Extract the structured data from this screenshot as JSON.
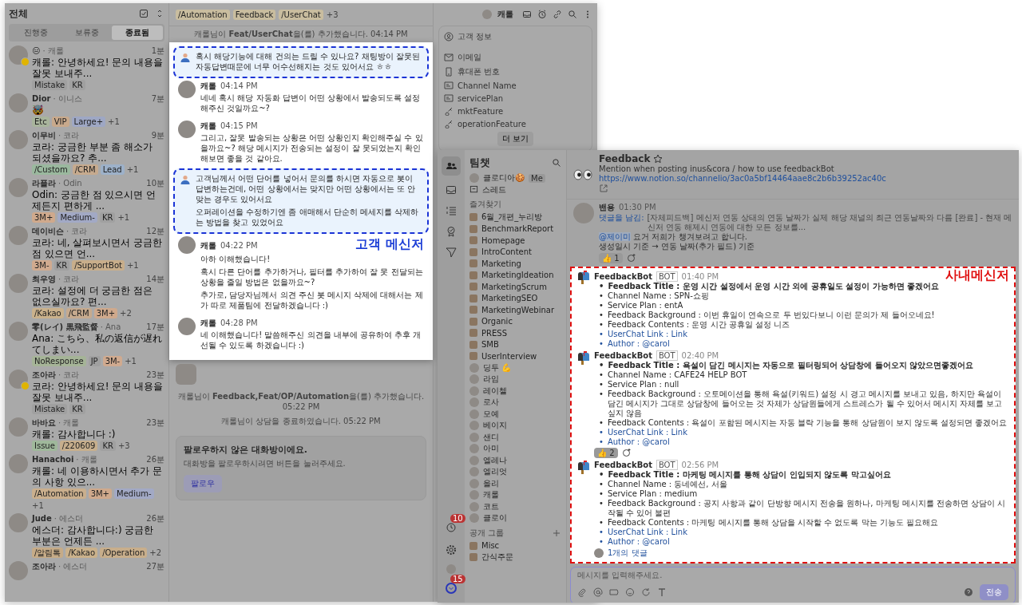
{
  "customer_window": {
    "inbox": {
      "title": "전체",
      "tabs": [
        {
          "label": "진행중",
          "selected": false
        },
        {
          "label": "보류중",
          "selected": false
        },
        {
          "label": "종료됨",
          "selected": true
        }
      ],
      "chats": [
        {
          "name": "😑",
          "agent": "· 캐롤",
          "time": "1분",
          "badge": true,
          "preview": "캐롤: 안녕하세요! 문의 내용을 잘못 보내주...",
          "tags": [
            {
              "label": "Mistake",
              "color": "#a0a0a0"
            },
            {
              "label": "KR",
              "color": "#a0a0a0"
            }
          ]
        },
        {
          "name": "Dior",
          "agent": "· 이니스",
          "time": "7분",
          "badge": false,
          "preview": "🤯",
          "tags": [
            {
              "label": "Etc",
              "color": "#a8b49c"
            },
            {
              "label": "VIP",
              "color": "#c8a98c"
            },
            {
              "label": "Large+",
              "color": "#9ea7c4"
            }
          ],
          "more": "+1"
        },
        {
          "name": "이무비",
          "agent": "· 코라",
          "time": "9분",
          "badge": false,
          "preview": "코라: 궁금한 부분 좀 해소가 되셨을까요? 추...",
          "tags": [
            {
              "label": "/Custom",
              "color": "#9ab89e"
            },
            {
              "label": "/CRM",
              "color": "#c6aa8e"
            },
            {
              "label": "Lead",
              "color": "#9db1c9"
            }
          ],
          "more": "+1"
        },
        {
          "name": "라플라",
          "agent": "· Odin",
          "time": "10분",
          "badge": false,
          "preview": "Odin: 궁금한 점 있으시면 언제든지 편하게 ...",
          "tags": [
            {
              "label": "3M+",
              "color": "#cfa98c"
            },
            {
              "label": "Medium-",
              "color": "#a2a9c5"
            },
            {
              "label": "KR",
              "color": "#a0a0a0"
            }
          ],
          "more": "+1"
        },
        {
          "name": "데이비슨",
          "agent": "· 코라",
          "time": "12분",
          "badge": false,
          "preview": "코라: 네, 살펴보시면서 궁금한 점 있으면 언...",
          "tags": [
            {
              "label": "3M-",
              "color": "#d0aa8f"
            },
            {
              "label": "KR",
              "color": "#a0a0a0"
            },
            {
              "label": "/SupportBot",
              "color": "#c8ae8b"
            }
          ],
          "more": "+1"
        },
        {
          "name": "최우영",
          "agent": "· 코라",
          "time": "14분",
          "badge": false,
          "preview": "코라: 설정에 더 궁금한 점은 없으실까요? 편...",
          "tags": [
            {
              "label": "/Kakao",
              "color": "#cab18b"
            },
            {
              "label": "/CRM",
              "color": "#c6aa8e"
            },
            {
              "label": "3M+",
              "color": "#cfa98c"
            }
          ],
          "more": "+2"
        },
        {
          "name": "零(レイ) 黒飛監督",
          "agent": "· Ana",
          "time": "17분",
          "badge": false,
          "preview": "Ana: こちら、私の返信が遅れてしまい...",
          "tags": [
            {
              "label": "NoResponse",
              "color": "#a5b497"
            },
            {
              "label": "JP",
              "color": "#a0a0a0"
            },
            {
              "label": "3M-",
              "color": "#d0aa8f"
            }
          ],
          "more": "+1"
        },
        {
          "name": "조아라",
          "agent": "· 코라",
          "time": "23분",
          "badge": true,
          "preview": "코라: 안녕하세요! 문의 내용을 잘못 보내주...",
          "tags": [
            {
              "label": "Mistake",
              "color": "#a0a0a0"
            },
            {
              "label": "KR",
              "color": "#a0a0a0"
            }
          ]
        },
        {
          "name": "바바요",
          "agent": "· 캐롤",
          "time": "23분",
          "badge": false,
          "preview": "캐롤: 감사합니다 :)",
          "tags": [
            {
              "label": "Issue",
              "color": "#9fb89b"
            },
            {
              "label": "/220609",
              "color": "#c7af8d"
            },
            {
              "label": "KR",
              "color": "#a0a0a0"
            }
          ],
          "more": "+3"
        },
        {
          "name": "Hanachoi",
          "agent": "· 캐롤",
          "time": "26분",
          "badge": false,
          "preview": "캐롤: 네 이용하시면서 추가 문의 사항 있으...",
          "tags": [
            {
              "label": "/Automation",
              "color": "#caaf8d"
            },
            {
              "label": "3M+",
              "color": "#cfa98c"
            },
            {
              "label": "Medium-",
              "color": "#a2a9c5"
            }
          ],
          "more": "+1"
        },
        {
          "name": "Jude",
          "agent": "· 에스더",
          "time": "26분",
          "badge": false,
          "preview": "에스더: 감사합니다:) 궁금한 부분은 언제든 ...",
          "tags": [
            {
              "label": "/알림톡",
              "color": "#c6ab87"
            },
            {
              "label": "/Kakao",
              "color": "#cab18b"
            },
            {
              "label": "/Operation",
              "color": "#c8ae8b"
            }
          ],
          "more": "+2"
        },
        {
          "name": "조아라",
          "agent": "· 에스더",
          "time": "27분",
          "badge": false
        }
      ]
    },
    "header": {
      "tags": [
        {
          "label": "/Automation",
          "color": "#c9bd9f"
        },
        {
          "label": "Feedback",
          "color": "#c9bd9f"
        },
        {
          "label": "/UserChat",
          "color": "#c9bd9f"
        }
      ],
      "more": "+3",
      "assignee": "캐롤"
    },
    "system_top": {
      "text": "캐롤님이 **Feat/UserChat**을(를) 추가했습니다.",
      "time": "04:14 PM"
    },
    "messages": [
      {
        "kind": "customer",
        "highlighted": true,
        "paragraphs": [
          "혹시 해당기능에 대해 건의는 드릴 수 있나요? 채팅방이 잘못된 자동답변때문에 너무 어수선해지는 것도 있어서요 ㅎㅎ"
        ]
      },
      {
        "kind": "agent",
        "highlighted": false,
        "author": "캐롤",
        "time": "04:14 PM",
        "paragraphs": [
          "네네 혹시 해당 자동화 답변이 어떤 상황에서 발송되도록 설정해주신 것일까요~?"
        ]
      },
      {
        "kind": "agent",
        "highlighted": false,
        "author": "캐롤",
        "time": "04:15 PM",
        "paragraphs": [
          "그리고, 잘못 발송되는 상황은 어떤 상황인지 확인해주실 수 있을까요~? 해당 메시지가 전송되는 설정이 잘 못되었는지 확인해보면 좋을 것 같아요."
        ]
      },
      {
        "kind": "customer",
        "highlighted": true,
        "paragraphs": [
          "고객님께서 어떤 단어를 넣어서 문의를 하시면 자동으로 봇이 답변하는건데, 어떤 상황에서는 맞지만 어떤 상황에서는 또 안 맞는 경우도 있어서요",
          "오퍼레이션을 수정하기엔 좀 애매해서 단순히 메세지를 삭제하는 방법을 찾고 있었어요"
        ]
      },
      {
        "kind": "agent",
        "highlighted": false,
        "author": "캐롤",
        "time": "04:22 PM",
        "paragraphs": [
          "아하 이해했습니다!",
          "혹시 다른 단어를 추가하거나, 필터를 추가하여 잘 못 전달되는 상황을 줄일 방법은 없을까요~?",
          "추가로, 담당자님께서 의견 주신 봇 메시지 삭제에 대해서는 제가 따로 제품팀에 전달하겠습니다 :)"
        ]
      },
      {
        "kind": "agent",
        "highlighted": false,
        "author": "캐롤",
        "time": "04:28 PM",
        "paragraphs": [
          "네 이해했습니다! 말씀해주신 의견을 내부에 공유하여 추후 개선될 수 있도록 하겠습니다 :)"
        ]
      }
    ],
    "annotation": "고객 메신저",
    "events": [
      {
        "text": "캐롤님이 **Feedback,Feat/OP/Automation**을(를) 추가했습니다.",
        "time": "05:22 PM"
      },
      {
        "text": "캐롤님이 상담을 종료하였습니다.",
        "time": "05:22 PM"
      }
    ],
    "follow": {
      "title": "팔로우하지 않은 대화방이에요.",
      "description": "대화방을 팔로우하시려면 버튼을 눌러주세요.",
      "button": "팔로우"
    },
    "info_panel": {
      "title": "고객 정보",
      "fields": [
        {
          "label": "이메일",
          "kind": "mail"
        },
        {
          "label": "휴대폰 번호",
          "kind": "phone"
        },
        {
          "label": "Channel Name",
          "kind": "card"
        },
        {
          "label": "servicePlan",
          "kind": "card"
        },
        {
          "label": "mktFeature",
          "kind": "key"
        },
        {
          "label": "operationFeature",
          "kind": "key"
        }
      ],
      "more": "더 보기"
    }
  },
  "team_window": {
    "rail_badges": [
      "10",
      "15"
    ],
    "title": "팀챗",
    "me": {
      "name": "클로디아🍪",
      "badge": "Me"
    },
    "threads": "스레드",
    "favorites_title": "즐겨찾기",
    "favorites": [
      {
        "name": "6월_개편_누리방",
        "kind": "channel"
      },
      {
        "name": "BenchmarkReport",
        "kind": "channel"
      },
      {
        "name": "Homepage",
        "kind": "channel"
      },
      {
        "name": "IntroContent",
        "kind": "channel"
      },
      {
        "name": "Marketing",
        "kind": "channel"
      },
      {
        "name": "MarketingIdeation",
        "kind": "channel"
      },
      {
        "name": "MarketingScrum",
        "kind": "channel"
      },
      {
        "name": "MarketingSEO",
        "kind": "channel"
      },
      {
        "name": "MarketingWebinar",
        "kind": "channel"
      },
      {
        "name": "Organic",
        "kind": "channel"
      },
      {
        "name": "PRESS",
        "kind": "channel"
      },
      {
        "name": "SMB",
        "kind": "channel"
      },
      {
        "name": "UserInterview",
        "kind": "channel"
      },
      {
        "name": "딩두 💪",
        "kind": "member"
      },
      {
        "name": "라임",
        "kind": "member"
      },
      {
        "name": "레이첼",
        "kind": "member"
      },
      {
        "name": "로사",
        "kind": "member"
      },
      {
        "name": "모예",
        "kind": "member"
      },
      {
        "name": "베이지",
        "kind": "member"
      },
      {
        "name": "샌디",
        "kind": "member"
      },
      {
        "name": "아미",
        "kind": "member"
      },
      {
        "name": "엘레나",
        "kind": "member"
      },
      {
        "name": "엘리엇",
        "kind": "member"
      },
      {
        "name": "올리",
        "kind": "member"
      },
      {
        "name": "캐롤",
        "kind": "member"
      },
      {
        "name": "코트",
        "kind": "member"
      },
      {
        "name": "클로이",
        "kind": "member"
      }
    ],
    "groups_title": "공개 그룹",
    "groups": [
      {
        "name": "Misc",
        "kind": "channel"
      },
      {
        "name": "간식주문",
        "kind": "channel"
      }
    ],
    "channel": {
      "name": "Feedback",
      "description": "Mention when posting inus&cora / how to use feedbackBot",
      "link": "https://www.notion.so/channelio/3ac0a5bf14464aae8c2b6b39252ac40c"
    },
    "first_message": {
      "author": "밴용",
      "time": "01:30 PM",
      "reply_label": "댓글을 남김:",
      "reply_text": "[자체피드백] 메신저 연동 상태의 연동 날짜가 실제 해당 채널의 최근 연동날짜와 다름 [완료] - 현재 메신저 연동 해제시 연동에 대한 모든 정보를...",
      "mention": "@제이미",
      "text": "요거 저희가 챙겨보려고 합니다.",
      "line2": "생성일시 기준 → 연동 날짜(추가 필드) 기준",
      "reactions": [
        {
          "emoji": "👍",
          "count": "1"
        }
      ]
    },
    "bot_messages": [
      {
        "author": "FeedbackBot",
        "badge": "BOT",
        "time": "01:40 PM",
        "bullet": "•",
        "fields": [
          {
            "label": "Feedback Title :",
            "value": "운영 시간 설정에서 운영 시간 외에 공휴일도 설정이 가능하면 좋겠어요",
            "kind": "title"
          },
          {
            "label": "Channel Name :",
            "value": "SPN-쇼핑",
            "kind": "text"
          },
          {
            "label": "Service Plan :",
            "value": "entA",
            "kind": "text"
          },
          {
            "label": "Feedback Background :",
            "value": "이번 휴일이 연속으로 두 번있다보니 이런 문의가 제 들어오네요!",
            "kind": "text"
          },
          {
            "label": "Feedback Contents :",
            "value": "운영 시간 공휴일 설정 니즈",
            "kind": "text"
          },
          {
            "label": "UserChat Link :",
            "value": "Link",
            "kind": "link"
          },
          {
            "label": "Author :",
            "value": "@carol",
            "kind": "link"
          }
        ]
      },
      {
        "author": "FeedbackBot",
        "badge": "BOT",
        "time": "02:40 PM",
        "bullet": "•",
        "fields": [
          {
            "label": "Feedback Title :",
            "value": "욕설이 담긴 메시지는 자동으로 필터링되어 상담창에 들어오지 않았으면좋겠어요",
            "kind": "title"
          },
          {
            "label": "Channel Name :",
            "value": "CAFE24 HELP BOT",
            "kind": "text"
          },
          {
            "label": "Service Plan :",
            "value": "null",
            "kind": "text"
          },
          {
            "label": "Feedback Background :",
            "value": "오토메이션을 통해 욕설(키워드) 설정 시 경고 메시지를 보내고 있음, 하지만 욕설이 담긴 메시지가 그대로 상담창에 들어오는 것 자체가 상담원들에게 스트레스가 될 수 있어서 메시지 자체를 보고 싶지 않음",
            "kind": "text"
          },
          {
            "label": "Feedback Contents :",
            "value": "욕설이 포함된 메시지는 자동 블락 기능을 통해 상담원이 보지 않도록 설정되면 좋겠어요",
            "kind": "text"
          },
          {
            "label": "UserChat Link :",
            "value": "Link",
            "kind": "link"
          },
          {
            "label": "Author :",
            "value": "@carol",
            "kind": "link"
          }
        ],
        "reactions": [
          {
            "emoji": "👍",
            "count": "2"
          }
        ]
      },
      {
        "author": "FeedbackBot",
        "badge": "BOT",
        "time": "02:56 PM",
        "bullet": "•",
        "fields": [
          {
            "label": "Feedback Title :",
            "value": "마케팅 메시지를 통해 상담이 인입되지 않도록 막고싶어요",
            "kind": "title"
          },
          {
            "label": "Channel Name :",
            "value": "동네예선, 서울",
            "kind": "text"
          },
          {
            "label": "Service Plan :",
            "value": "medium",
            "kind": "text"
          },
          {
            "label": "Feedback Background :",
            "value": "공지 사항과 같이 단방향 메시지 전송을 원하나, 마케팅 메시지를 전송하면 상담이 시작될 수 있어 불편",
            "kind": "text"
          },
          {
            "label": "Feedback Contents :",
            "value": "마케팅 메시지를 통해 상담을 시작할 수 없도록 막는 기능도 필요해요",
            "kind": "text"
          },
          {
            "label": "UserChat Link :",
            "value": "Link",
            "kind": "link"
          },
          {
            "label": "Author :",
            "value": "@carol",
            "kind": "link"
          }
        ],
        "replies": "1개의 댓글"
      }
    ],
    "annotation": "사내메신저",
    "composer": {
      "placeholder": "메시지를 입력해주세요.",
      "send": "전송"
    }
  }
}
